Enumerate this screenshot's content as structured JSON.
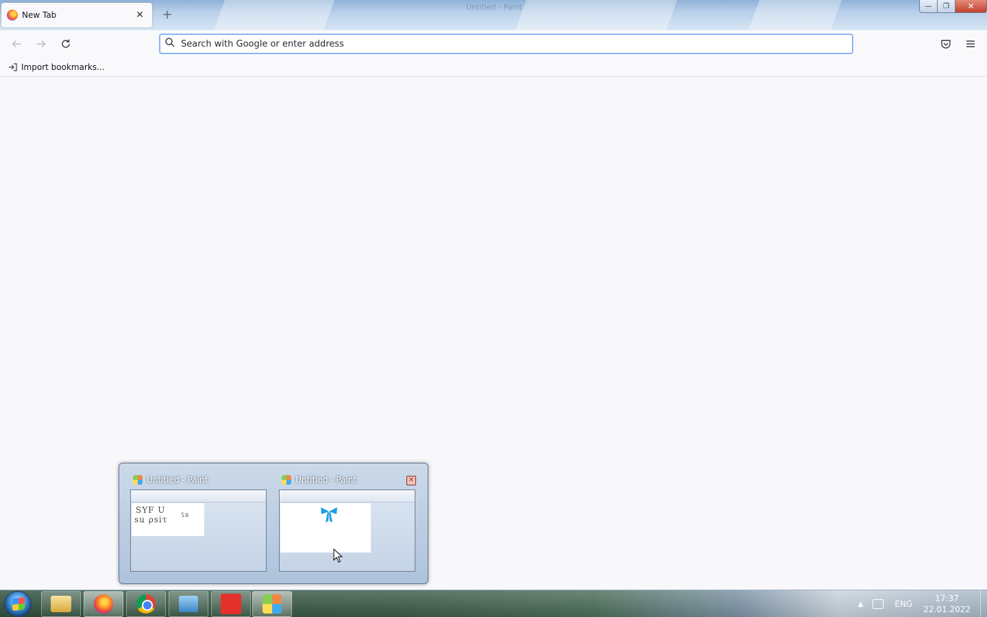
{
  "window": {
    "title": "Untitled - Paint",
    "minimize_glyph": "—",
    "maximize_glyph": "❐",
    "close_glyph": "✕"
  },
  "browser": {
    "tab": {
      "title": "New Tab",
      "close_glyph": "✕"
    },
    "new_tab_glyph": "+",
    "urlbar": {
      "placeholder": "Search with Google or enter address",
      "value": ""
    },
    "bookmarks_toolbar": {
      "import_label": "Import bookmarks..."
    }
  },
  "preview": {
    "items": [
      {
        "title": "Untitled - Paint",
        "has_close": false
      },
      {
        "title": "Untitled - Paint",
        "has_close": true,
        "close_glyph": "✕"
      }
    ],
    "doodle_text": [
      "SYF U",
      "su ρsiτ",
      "ઽs"
    ]
  },
  "taskbar": {
    "apps": [
      {
        "name": "file-explorer",
        "icon": "folder-icon"
      },
      {
        "name": "firefox",
        "icon": "firefox-icon",
        "active": true
      },
      {
        "name": "chrome",
        "icon": "chrome-icon"
      },
      {
        "name": "control-panel",
        "icon": "control-panel-icon"
      },
      {
        "name": "anydesk",
        "icon": "anydesk-icon"
      },
      {
        "name": "paint",
        "icon": "paint-icon"
      }
    ],
    "tray": {
      "arrow_glyph": "▲",
      "language": "ENG",
      "time": "17:37",
      "date": "22.01.2022"
    }
  },
  "colors": {
    "focus_ring": "#8ab4f8",
    "anydesk_red": "#e3322b",
    "paint_bow_blue": "#1aa0e8"
  }
}
